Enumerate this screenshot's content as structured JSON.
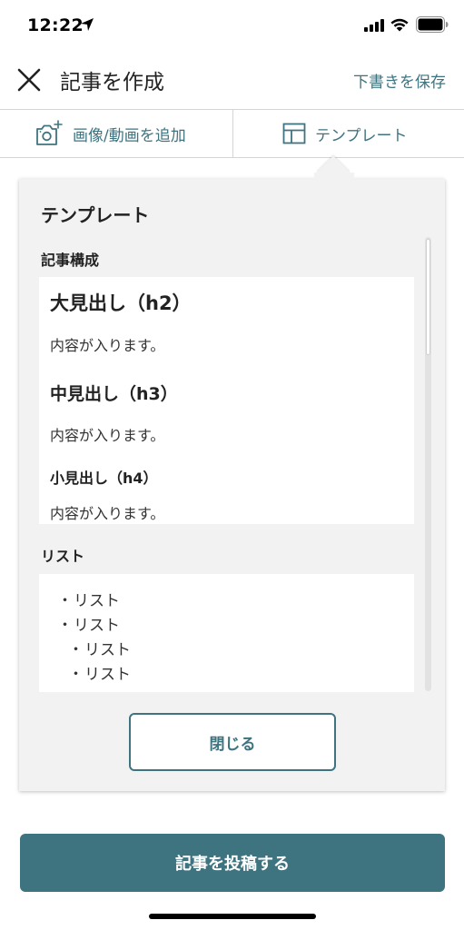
{
  "status": {
    "time": "12:22"
  },
  "header": {
    "title": "記事を作成",
    "save_draft": "下書きを保存"
  },
  "toolbar": {
    "media_label": "画像/動画を追加",
    "template_label": "テンプレート"
  },
  "panel": {
    "title": "テンプレート",
    "structure": {
      "label": "記事構成",
      "h2": "大見出し（h2）",
      "h2_body": "内容が入ります。",
      "h3": "中見出し（h3）",
      "h3_body": "内容が入ります。",
      "h4": "小見出し（h4）",
      "h4_body": "内容が入ります。"
    },
    "list": {
      "label": "リスト",
      "items": [
        {
          "bullet": "・",
          "text": "リスト"
        },
        {
          "bullet": "・",
          "text": "リスト"
        },
        {
          "bullet": "・",
          "text": "リスト"
        },
        {
          "bullet": "・",
          "text": "リスト"
        }
      ]
    },
    "close_label": "閉じる"
  },
  "footer": {
    "post_label": "記事を投稿する"
  },
  "colors": {
    "accent": "#3e7480",
    "panel_bg": "#f2f2f2"
  }
}
